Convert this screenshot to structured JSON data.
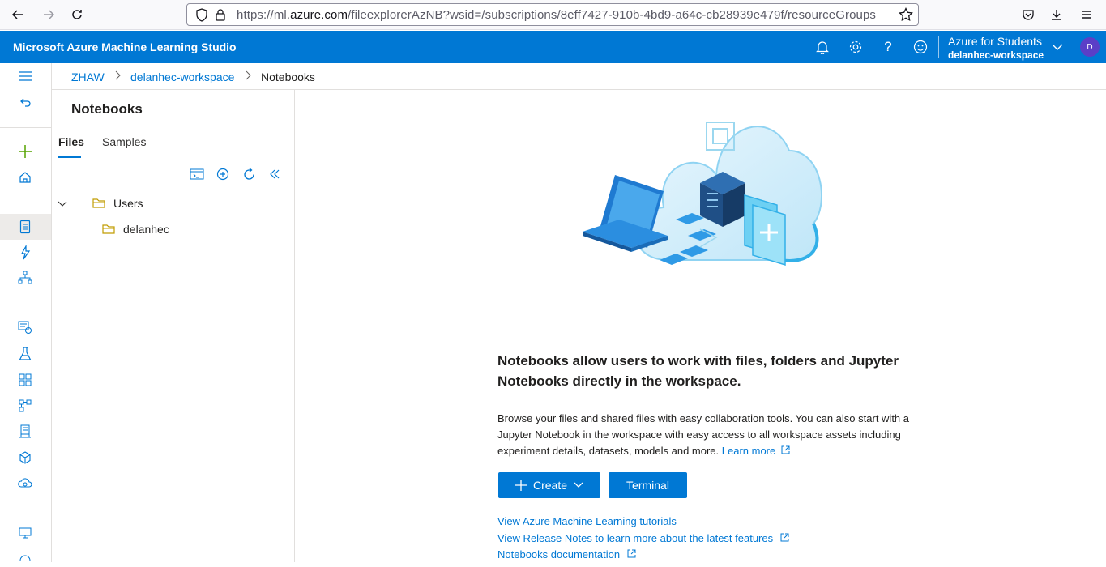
{
  "browser": {
    "url_prefix": "https://ml.",
    "url_domain": "azure.com",
    "url_rest": "/fileexplorerAzNB?wsid=/subscriptions/8eff7427-910b-4bd9-a64c-cb28939e479f/resourceGroups"
  },
  "header": {
    "title": "Microsoft Azure Machine Learning Studio",
    "account_directory": "Azure for Students",
    "account_workspace": "delanhec-workspace",
    "avatar_initial": "D"
  },
  "breadcrumb": {
    "items": [
      "ZHAW",
      "delanhec-workspace",
      "Notebooks"
    ]
  },
  "panel": {
    "title": "Notebooks",
    "tabs": [
      "Files",
      "Samples"
    ],
    "tree": [
      {
        "label": "Users",
        "level": 0,
        "expanded": true
      },
      {
        "label": "delanhec",
        "level": 1
      }
    ]
  },
  "main": {
    "heading": "Notebooks allow users to work with files, folders and Jupyter Notebooks directly in the workspace.",
    "description": "Browse your files and shared files with easy collaboration tools. You can also start with a Jupyter Notebook in the workspace with easy access to all workspace assets including experiment details, datasets, models and more.",
    "learn_more": "Learn more",
    "create_label": "Create",
    "terminal_label": "Terminal",
    "links": [
      "View Azure Machine Learning tutorials",
      "View Release Notes to learn more about the latest features",
      "Notebooks documentation"
    ]
  },
  "colors": {
    "accent": "#0078d4",
    "folder": "#c19c00"
  }
}
